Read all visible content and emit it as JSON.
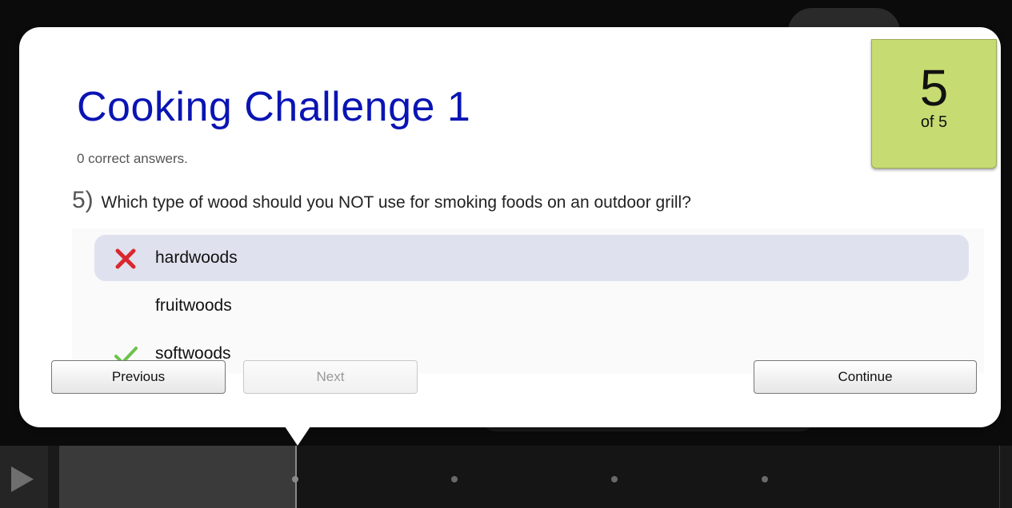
{
  "quiz": {
    "title": "Cooking Challenge 1",
    "score_text": "0 correct answers.",
    "counter": {
      "current": "5",
      "total_label": "of 5"
    },
    "question": {
      "number": "5)",
      "text": "Which type of wood should you NOT use for smoking foods on an outdoor grill?"
    },
    "answers": [
      {
        "label": "hardwoods",
        "status": "incorrect",
        "icon": "x-mark-icon",
        "selected": true
      },
      {
        "label": "fruitwoods",
        "status": "none",
        "icon": "",
        "selected": false
      },
      {
        "label": "softwoods",
        "status": "correct",
        "icon": "check-mark-icon",
        "selected": false
      }
    ],
    "buttons": {
      "previous": "Previous",
      "next": "Next",
      "continue": "Continue"
    },
    "colors": {
      "title": "#0a14b4",
      "badge": "#c6dc73",
      "selected_answer": "#dfe2ee",
      "incorrect": "#d9282e",
      "correct": "#6cc24a"
    }
  },
  "player": {
    "play_icon": "play-icon",
    "progress": 0.25,
    "markers": [
      0.25,
      0.42,
      0.59,
      0.75
    ]
  }
}
